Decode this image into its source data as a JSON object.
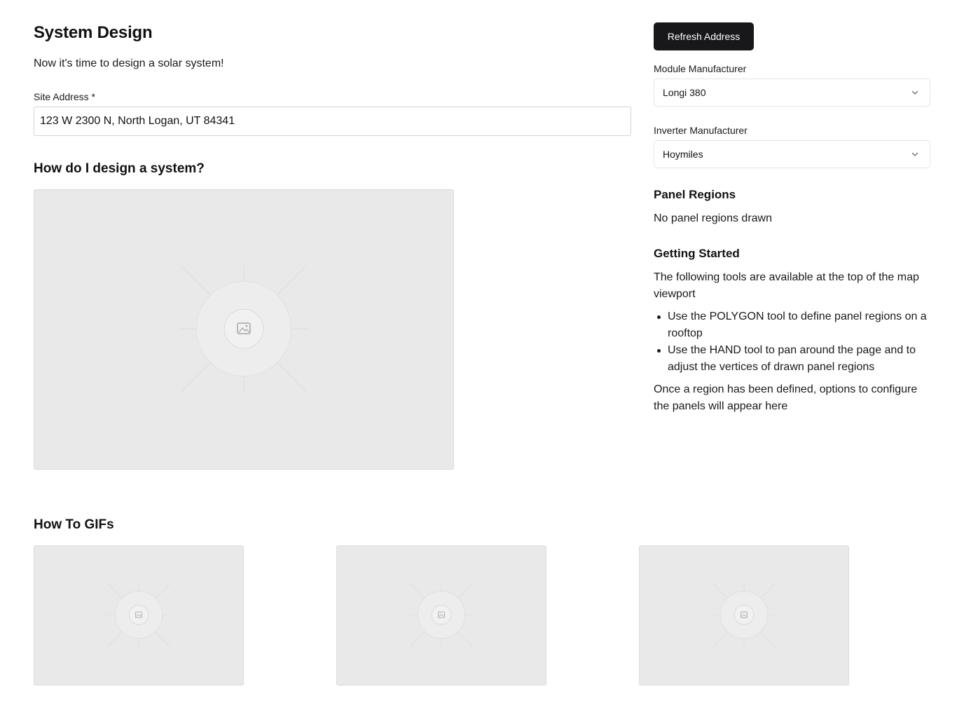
{
  "page": {
    "title": "System Design",
    "intro": "Now it's time to design a solar system!"
  },
  "site_address": {
    "label": "Site Address *",
    "value": "123 W 2300 N, North Logan, UT 84341"
  },
  "how_to_design": {
    "heading": "How do I design a system?",
    "image_icon": "image-icon"
  },
  "how_to_gifs": {
    "heading": "How To GIFs",
    "items": [
      {
        "icon": "image-icon"
      },
      {
        "icon": "image-icon"
      },
      {
        "icon": "image-icon"
      }
    ]
  },
  "sidebar": {
    "refresh_label": "Refresh Address",
    "module": {
      "label": "Module Manufacturer",
      "value": "Longi 380",
      "icon": "chevron-down-icon"
    },
    "inverter": {
      "label": "Inverter Manufacturer",
      "value": "Hoymiles",
      "icon": "chevron-down-icon"
    },
    "panel_regions": {
      "heading": "Panel Regions",
      "empty_text": "No panel regions drawn"
    },
    "getting_started": {
      "heading": "Getting Started",
      "intro": "The following tools are available at the top of the map viewport",
      "bullets": [
        "Use the POLYGON tool to define panel regions on a rooftop",
        "Use the HAND tool to pan around the page and to adjust the vertices of drawn panel regions"
      ],
      "outro": "Once a region has been defined, options to configure the panels will appear here"
    }
  },
  "colors": {
    "button_bg": "#18181b",
    "placeholder_bg": "#e9e9e9",
    "input_border": "#d4d4d8"
  }
}
